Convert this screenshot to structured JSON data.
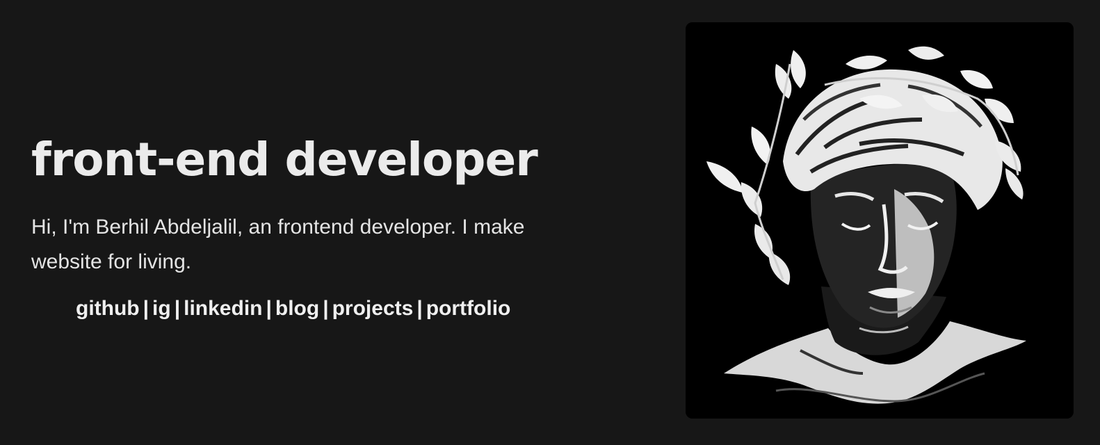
{
  "hero": {
    "title": "front-end developer",
    "bio": "Hi, I'm Berhil Abdeljalil, an frontend developer. I make website for living.",
    "links": [
      {
        "label": "github"
      },
      {
        "label": "ig"
      },
      {
        "label": "linkedin"
      },
      {
        "label": "blog"
      },
      {
        "label": "projects"
      },
      {
        "label": "portfolio"
      }
    ],
    "separator": "|"
  },
  "portrait": {
    "icon": "laurel-statue-portrait-icon"
  },
  "colors": {
    "background": "#171717",
    "text": "#ececec",
    "portrait_background": "#000000"
  }
}
